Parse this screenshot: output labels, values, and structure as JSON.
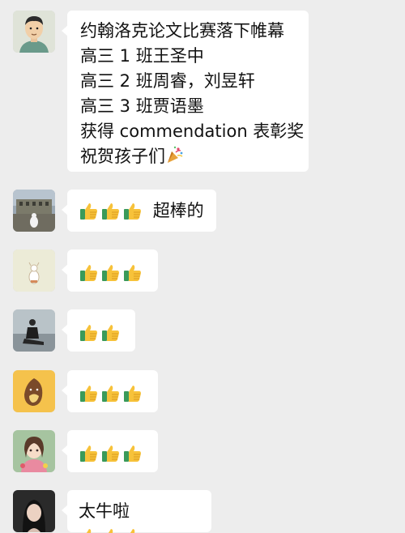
{
  "messages": [
    {
      "avatar": "cartoon-man-avatar",
      "lines": [
        "约翰洛克论文比赛落下帷幕",
        "高三 1 班王圣中",
        "高三 2 班周睿，刘昱轩",
        "高三 3 班贾语墨",
        "获得 commendation 表彰奖",
        "祝贺孩子们"
      ],
      "emoji": "party-popper-icon"
    },
    {
      "avatar": "building-photo-avatar",
      "thumbs": 3,
      "text_after": "超棒的"
    },
    {
      "avatar": "small-figure-avatar",
      "thumbs": 3
    },
    {
      "avatar": "person-sitting-avatar",
      "thumbs": 2
    },
    {
      "avatar": "sweet-potato-avatar",
      "thumbs": 3
    },
    {
      "avatar": "anime-girl-avatar",
      "thumbs": 3
    },
    {
      "avatar": "woman-portrait-avatar",
      "text_before": "太牛啦",
      "thumbs": 3
    }
  ],
  "colors": {
    "background": "#ededed",
    "bubble": "#ffffff",
    "text": "#111111",
    "thumb": "#f7c23a",
    "sleeve": "#3a9a5a"
  }
}
